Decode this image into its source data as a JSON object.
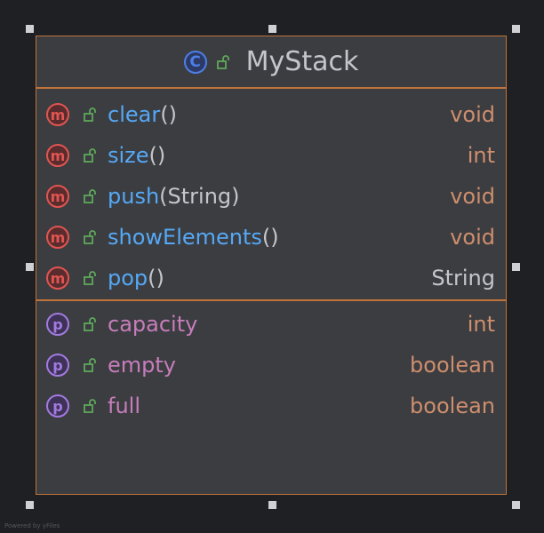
{
  "class": {
    "icon_letter": "C",
    "name": "MyStack"
  },
  "methods": [
    {
      "badge": "m",
      "name": "clear",
      "params": "()",
      "type": "void",
      "type_kind": "keyword"
    },
    {
      "badge": "m",
      "name": "size",
      "params": "()",
      "type": "int",
      "type_kind": "keyword"
    },
    {
      "badge": "m",
      "name": "push",
      "params": "(String)",
      "type": "void",
      "type_kind": "keyword"
    },
    {
      "badge": "m",
      "name": "showElements",
      "params": "()",
      "type": "void",
      "type_kind": "keyword"
    },
    {
      "badge": "m",
      "name": "pop",
      "params": "()",
      "type": "String",
      "type_kind": "class"
    }
  ],
  "properties": [
    {
      "badge": "p",
      "name": "capacity",
      "type": "int"
    },
    {
      "badge": "p",
      "name": "empty",
      "type": "boolean"
    },
    {
      "badge": "p",
      "name": "full",
      "type": "boolean"
    }
  ],
  "watermark": "Powered by yFiles",
  "colors": {
    "border": "#c0733a",
    "method_name": "#56a8f5",
    "property_name": "#c77dbb",
    "keyword_type": "#cf8e6d",
    "method_badge": "#e05552",
    "property_badge": "#a37be0",
    "class_icon": "#4d7fe6",
    "lock_icon": "#5fa85a"
  },
  "icons": {
    "class": "class-icon",
    "visibility": "open-lock-icon",
    "method": "method-icon",
    "property": "property-icon"
  }
}
